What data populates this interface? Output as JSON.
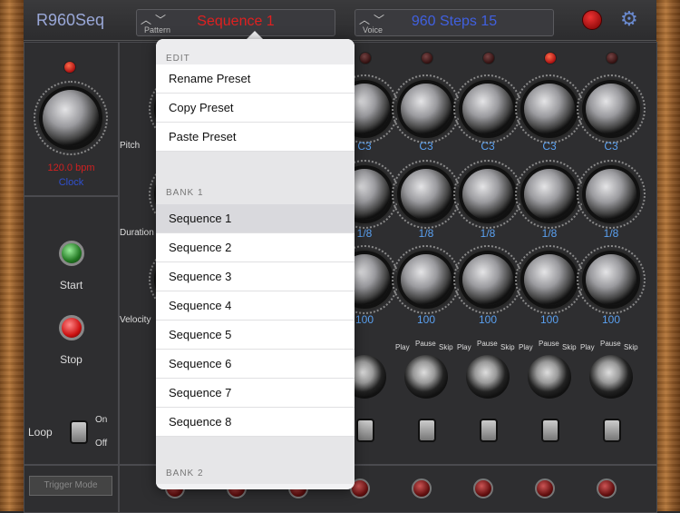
{
  "app": {
    "title": "R960Seq"
  },
  "pattern": {
    "label": "Pattern",
    "value": "Sequence 1",
    "value_color": "#e02020"
  },
  "voice": {
    "label": "Voice",
    "value": "960 Steps 15",
    "value_color": "#4060e0"
  },
  "icons": {
    "record": "record-icon",
    "settings": "gear-icon"
  },
  "left": {
    "bpm": "120.0 bpm",
    "clock": "Clock",
    "start": "Start",
    "stop": "Stop",
    "loop": "Loop",
    "on": "On",
    "off": "Off",
    "trigger_mode": "Trigger Mode"
  },
  "rows": {
    "pitch": "Pitch",
    "duration": "Duration",
    "velocity": "Velocity"
  },
  "steps": [
    {
      "pitch": "C3",
      "duration": "1/8",
      "velocity": "100"
    },
    {
      "pitch": "C3",
      "duration": "1/8",
      "velocity": "100"
    },
    {
      "pitch": "C3",
      "duration": "1/8",
      "velocity": "100"
    },
    {
      "pitch": "C3",
      "duration": "1/8",
      "velocity": "100"
    },
    {
      "pitch": "C3",
      "duration": "1/8",
      "velocity": "100"
    }
  ],
  "mode": {
    "play": "Play",
    "pause": "Pause",
    "skip": "Skip"
  },
  "menu": {
    "edit_header": "EDIT",
    "edit_items": [
      "Rename Preset",
      "Copy Preset",
      "Paste Preset"
    ],
    "bank1_header": "BANK 1",
    "bank1_items": [
      "Sequence 1",
      "Sequence 2",
      "Sequence 3",
      "Sequence 4",
      "Sequence 5",
      "Sequence 6",
      "Sequence 7",
      "Sequence 8"
    ],
    "selected": "Sequence 1",
    "bank2_header": "BANK 2"
  }
}
